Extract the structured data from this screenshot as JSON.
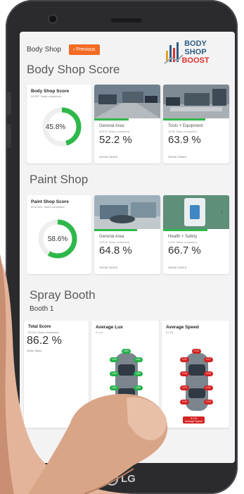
{
  "device": {
    "brand": "LG"
  },
  "header": {
    "breadcrumb": "Body Shop",
    "previous_button": "‹ Previous",
    "logo": {
      "line1": "BODY",
      "line2": "SHOP",
      "line3": "BOOST"
    }
  },
  "body_shop": {
    "title": "Body Shop Score",
    "summary": {
      "label": "Body Shop Score",
      "meta": "53/267 Tasks completed",
      "value": "45.8%",
      "fraction": 0.458
    },
    "areas": [
      {
        "label": "General Area",
        "meta": "80/270 Tasks completed",
        "value": "52.2 %",
        "show": "SHOW TASKS"
      },
      {
        "label": "Tools + Equipment",
        "meta": "23/36 Tasks completed",
        "value": "63.9 %",
        "show": "SHOW TASKS"
      }
    ]
  },
  "paint_shop": {
    "title": "Paint Shop",
    "summary": {
      "label": "Paint Shop Score",
      "meta": "620/1061 Tasks completed",
      "value": "58.6%",
      "fraction": 0.586
    },
    "areas": [
      {
        "label": "General Area",
        "meta": "10/105 Tasks completed",
        "value": "64.8 %",
        "show": "SHOW TASKS"
      },
      {
        "label": "Health + Safety",
        "meta": "12/18 Tasks completed",
        "value": "66.7 %",
        "show": "SHOW TASKS"
      }
    ]
  },
  "spray_booth": {
    "title": "Spray Booth",
    "subtitle": "Booth 1",
    "total": {
      "label": "Total Score",
      "meta": "87/101 Tasks completed",
      "value": "86.2 %",
      "show": "Show Tasks"
    },
    "lux": {
      "title": "Average Lux",
      "meta": "0 Lux",
      "readings": [
        "1200",
        "1210",
        "1200",
        "1210",
        "1200",
        "1200",
        "1200",
        "1210",
        "1200"
      ]
    },
    "speed": {
      "title": "Average Speed",
      "meta": "0.175",
      "readings": [
        "0.18",
        "0.21",
        "0.17",
        "0.18",
        "0.16",
        "0.20",
        "0.21",
        "0.20",
        "0.15"
      ],
      "average": "0.175",
      "average_label": "Average Speed"
    }
  },
  "colors": {
    "accent": "#f26a23",
    "good": "#2fb84a",
    "bad": "#d32323",
    "brand_blue": "#2f5f86",
    "brand_red": "#e0322c"
  }
}
